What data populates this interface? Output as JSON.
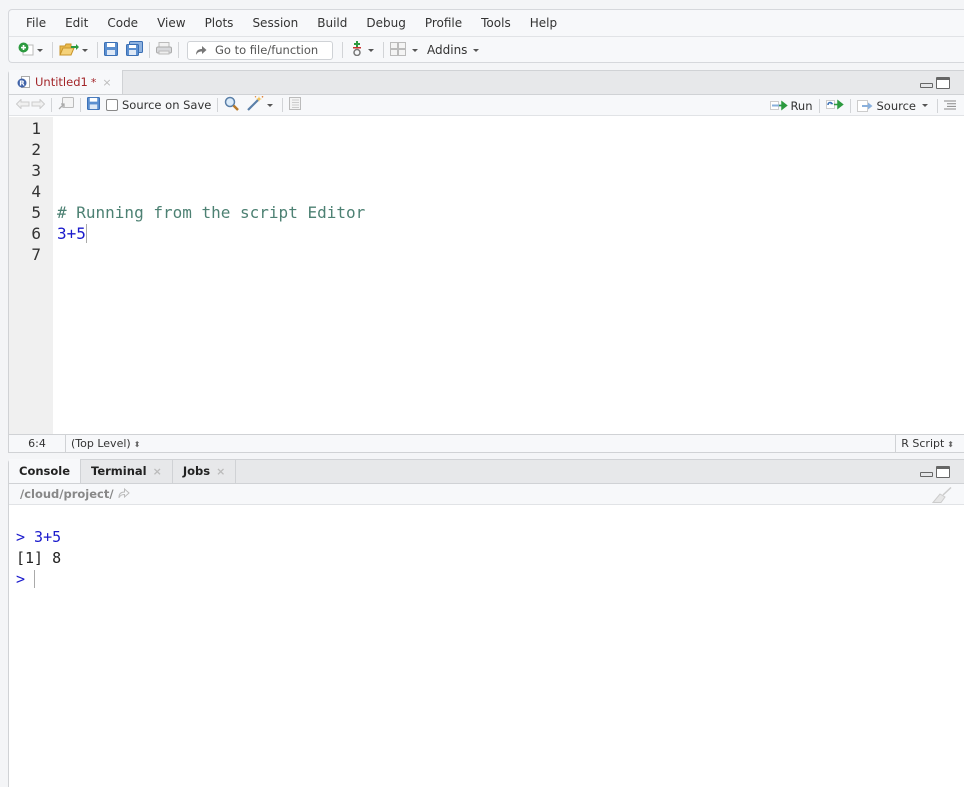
{
  "menubar": {
    "items": [
      "File",
      "Edit",
      "Code",
      "View",
      "Plots",
      "Session",
      "Build",
      "Debug",
      "Profile",
      "Tools",
      "Help"
    ]
  },
  "toolbar": {
    "goto_placeholder": "Go to file/function",
    "addins_label": "Addins"
  },
  "editor": {
    "tab": {
      "name": "Untitled1",
      "modified_marker": "*",
      "close": "×"
    },
    "toolbar": {
      "source_on_save_label": "Source on Save",
      "source_on_save_checked": false,
      "run_label": "Run",
      "source_label": "Source"
    },
    "lines": [
      {
        "number": "1",
        "text": "",
        "kind": "plain"
      },
      {
        "number": "2",
        "text": "",
        "kind": "plain"
      },
      {
        "number": "3",
        "text": "",
        "kind": "plain"
      },
      {
        "number": "4",
        "text": "",
        "kind": "plain"
      },
      {
        "number": "5",
        "text": "# Running from the script Editor",
        "kind": "comment"
      },
      {
        "number": "6",
        "text": "3+5",
        "kind": "number"
      },
      {
        "number": "7",
        "text": "",
        "kind": "plain"
      }
    ],
    "status": {
      "cursor_position": "6:4",
      "scope": "(Top Level)",
      "file_type": "R Script",
      "updown_glyph": "⬍"
    }
  },
  "console": {
    "tabs": [
      {
        "label": "Console",
        "closable": false,
        "active": true
      },
      {
        "label": "Terminal",
        "closable": true,
        "active": false
      },
      {
        "label": "Jobs",
        "closable": true,
        "active": false
      }
    ],
    "close_glyph": "×",
    "working_dir": "/cloud/project/",
    "lines": [
      {
        "prompt": ">",
        "text": " 3+5",
        "kind": "input"
      },
      {
        "prompt": "",
        "text": "[1] 8",
        "kind": "output"
      },
      {
        "prompt": ">",
        "text": " ",
        "kind": "input-active"
      }
    ]
  },
  "colors": {
    "tab_modified": "#a3262a",
    "comment": "#4d8173",
    "numeric": "#1a1acc",
    "prompt": "#1a1acc"
  }
}
